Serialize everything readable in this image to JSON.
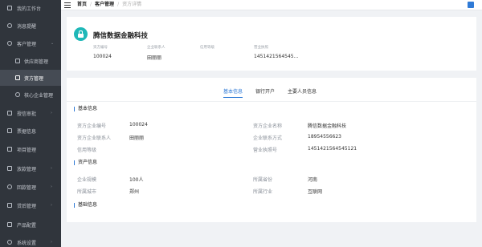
{
  "sidebar": {
    "items": [
      {
        "label": "我的工作台",
        "icon": "box-icon"
      },
      {
        "label": "消息提醒",
        "icon": "circle-icon"
      },
      {
        "label": "客户管理",
        "icon": "circle-icon",
        "chevron": "⌄"
      },
      {
        "label": "供应商管理",
        "icon": "box-icon"
      },
      {
        "label": "资方管理",
        "icon": "bank-icon"
      },
      {
        "label": "核心企业管理",
        "icon": "circle-icon"
      },
      {
        "label": "授信审批",
        "icon": "box-icon",
        "chevron": "›"
      },
      {
        "label": "票据信息",
        "icon": "box-icon"
      },
      {
        "label": "项目管理",
        "icon": "box-icon"
      },
      {
        "label": "放款管理",
        "icon": "box-icon",
        "chevron": "›"
      },
      {
        "label": "回款管理",
        "icon": "circle-icon",
        "chevron": "›"
      },
      {
        "label": "贷后管理",
        "icon": "box-icon",
        "chevron": "›"
      },
      {
        "label": "产品配置",
        "icon": "box-icon"
      },
      {
        "label": "系统设置",
        "icon": "circle-icon",
        "chevron": "›"
      }
    ]
  },
  "topbar": {
    "crumbs": [
      "首页",
      "/",
      "客户管理",
      "/",
      "资方详情"
    ]
  },
  "header": {
    "company_name": "腾信数据金融科技",
    "fields": [
      {
        "label": "资方编号",
        "value": "100024"
      },
      {
        "label": "企业联系人",
        "value": "田丽丽"
      },
      {
        "label": "信用等级",
        "value": ""
      },
      {
        "label": "营业执照",
        "value": "1451421564545..."
      }
    ]
  },
  "tabs": [
    "基本信息",
    "银行开户",
    "主要人员信息"
  ],
  "basic": {
    "title": "基本信息",
    "rows": [
      {
        "l1": "资方企业编号",
        "v1": "100024",
        "l2": "资方企业名称",
        "v2": "腾信数据金融科技"
      },
      {
        "l1": "资方企业联系人",
        "v1": "田丽丽",
        "l2": "企业联系方式",
        "v2": "18954556623"
      },
      {
        "l1": "信用等级",
        "v1": "",
        "l2": "营业执照号",
        "v2": "1451421564545121"
      }
    ]
  },
  "assets": {
    "title": "资产信息",
    "rows": [
      {
        "l1": "企业规模",
        "v1": "100人",
        "l2": "所属省份",
        "v2": "河南"
      },
      {
        "l1": "所属城市",
        "v1": "郑州",
        "l2": "所属行业",
        "v2": "互联网"
      }
    ]
  },
  "base": {
    "title": "基础信息"
  }
}
